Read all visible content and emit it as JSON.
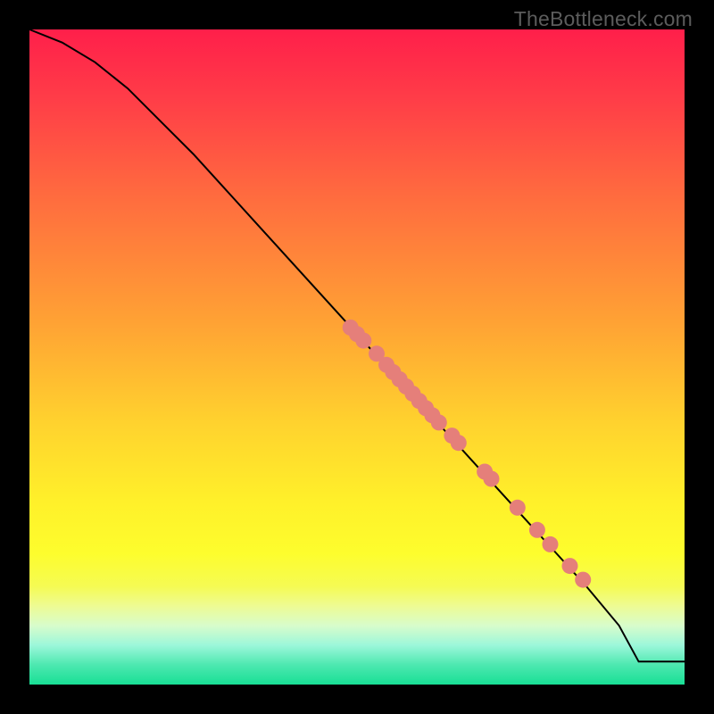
{
  "watermark": "TheBottleneck.com",
  "chart_data": {
    "type": "line",
    "title": "",
    "xlabel": "",
    "ylabel": "",
    "xlim": [
      0,
      100
    ],
    "ylim": [
      0,
      100
    ],
    "line": {
      "x": [
        0,
        5,
        10,
        15,
        20,
        25,
        30,
        35,
        40,
        45,
        50,
        55,
        60,
        65,
        70,
        75,
        80,
        85,
        90,
        93,
        100
      ],
      "y": [
        100,
        98,
        95,
        91,
        86,
        81,
        75.5,
        70,
        64.5,
        59,
        53.5,
        48,
        42.5,
        37,
        31.5,
        26,
        20.5,
        15,
        9,
        3.5,
        3.5
      ]
    },
    "markers": [
      {
        "x": 49,
        "y": 54.5
      },
      {
        "x": 50,
        "y": 53.5
      },
      {
        "x": 51,
        "y": 52.5
      },
      {
        "x": 53,
        "y": 50.5
      },
      {
        "x": 54.5,
        "y": 48.8
      },
      {
        "x": 55.5,
        "y": 47.7
      },
      {
        "x": 56.5,
        "y": 46.6
      },
      {
        "x": 57.5,
        "y": 45.5
      },
      {
        "x": 58.5,
        "y": 44.4
      },
      {
        "x": 59.5,
        "y": 43.3
      },
      {
        "x": 60.5,
        "y": 42.2
      },
      {
        "x": 61.5,
        "y": 41.1
      },
      {
        "x": 62.5,
        "y": 40.0
      },
      {
        "x": 64.5,
        "y": 38.0
      },
      {
        "x": 65.5,
        "y": 36.9
      },
      {
        "x": 69.5,
        "y": 32.5
      },
      {
        "x": 70.5,
        "y": 31.4
      },
      {
        "x": 74.5,
        "y": 27.0
      },
      {
        "x": 77.5,
        "y": 23.6
      },
      {
        "x": 79.5,
        "y": 21.4
      },
      {
        "x": 82.5,
        "y": 18.1
      },
      {
        "x": 84.5,
        "y": 16.0
      }
    ],
    "marker_color": "#e57f7a",
    "line_color": "#000000",
    "background_gradient": [
      "#ff1f4a",
      "#ffd22e",
      "#fdfd2d",
      "#18df95"
    ]
  }
}
